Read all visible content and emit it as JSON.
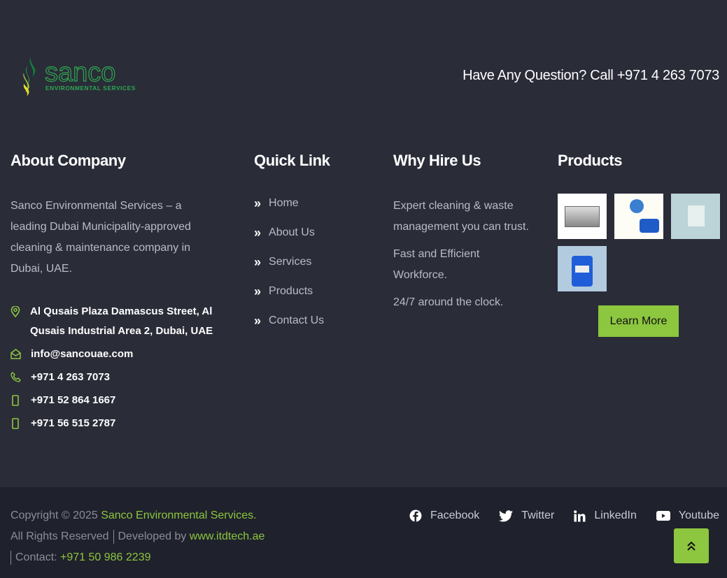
{
  "logo": {
    "name": "sanco",
    "tagline": "ENVIRONMENTAL SERVICES"
  },
  "header": {
    "question": "Have Any Question? Call +971 4 263 7073"
  },
  "about": {
    "title": "About Company",
    "text": "Sanco Environmental Services – a leading Dubai Municipality-approved cleaning & maintenance company in Dubai, UAE.",
    "address": "Al Qusais Plaza Damascus Street, Al Qusais Industrial Area 2, Dubai, UAE",
    "email": "info@sancouae.com",
    "phone": "+971 4 263 7073",
    "mobile1": "+971 52 864 1667",
    "mobile2": "+971 56 515 2787"
  },
  "quick": {
    "title": "Quick Link",
    "items": [
      "Home",
      "About Us",
      "Services",
      "Products",
      "Contact Us"
    ]
  },
  "why": {
    "title": "Why Hire Us",
    "items": [
      "Expert cleaning & waste management you can trust.",
      "Fast and Efficient Workforce.",
      "24/7 around the clock."
    ]
  },
  "products": {
    "title": "Products",
    "learn_more": "Learn More"
  },
  "bottom": {
    "copyright_prefix": "Copyright © 2025 ",
    "company": "Sanco Environmental Services.",
    "rights": "All Rights Reserved",
    "developed": "Developed by ",
    "dev_link": "www.itdtech.ae",
    "contact_label": "Contact: ",
    "contact_phone": "+971 50 986 2239",
    "social": [
      "Facebook",
      "Twitter",
      "LinkedIn",
      "Youtube"
    ]
  },
  "colors": {
    "accent": "#8dc63f",
    "bg": "#2a2c38",
    "bottom_bg": "#1f212c"
  }
}
